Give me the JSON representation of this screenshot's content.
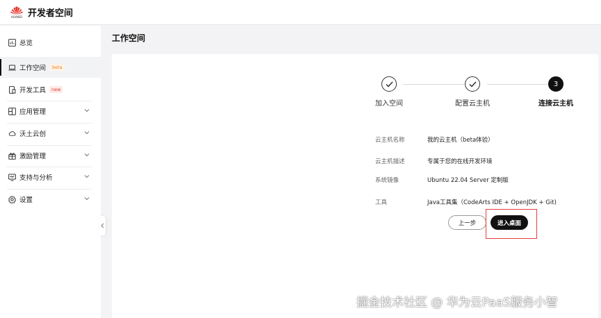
{
  "header": {
    "brand_logo_text": "HUAWEI",
    "title": "开发者空间"
  },
  "sidebar": {
    "items": [
      {
        "label": "总览",
        "icon": "overview-icon"
      },
      {
        "label": "工作空间",
        "icon": "laptop-icon",
        "badge": "beta"
      },
      {
        "label": "开发工具",
        "icon": "device-icon",
        "badge": "new"
      },
      {
        "label": "应用管理",
        "icon": "app-icon"
      },
      {
        "label": "沃土云创",
        "icon": "cloud-icon"
      },
      {
        "label": "激励管理",
        "icon": "gift-icon"
      },
      {
        "label": "支持与分析",
        "icon": "monitor-icon"
      },
      {
        "label": "设置",
        "icon": "gear-icon"
      }
    ]
  },
  "main": {
    "page_title": "工作空间",
    "steps": [
      {
        "label": "加入空间",
        "status": "done"
      },
      {
        "label": "配置云主机",
        "status": "done"
      },
      {
        "label": "连接云主机",
        "status": "active",
        "number": "3"
      }
    ],
    "info": [
      {
        "key": "云主机名称",
        "value": "我的云主机（beta体验）"
      },
      {
        "key": "云主机描述",
        "value": "专属于您的在线开发环境"
      },
      {
        "key": "系统镜像",
        "value": "Ubuntu 22.04 Server 定制版"
      },
      {
        "key": "工具",
        "value": "Java工具集（CodeArts IDE + OpenJDK + Git)"
      }
    ],
    "buttons": {
      "prev": "上一步",
      "enter_desktop": "进入桌面"
    }
  },
  "watermark": "掘金技术社区 @ 华为云PaaS服务小智",
  "colors": {
    "brand_red": "#e8342b",
    "primary_button": "#111111",
    "highlight_border": "#e0403a",
    "beta_tag": "#e8802b"
  }
}
